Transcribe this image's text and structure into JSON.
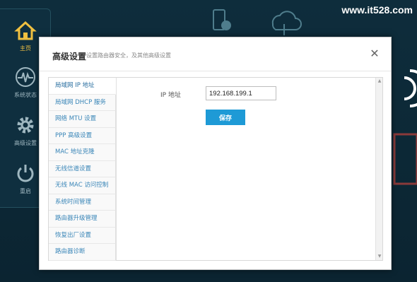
{
  "watermark": "www.it528.com",
  "rail": {
    "items": [
      {
        "label": "主页",
        "icon": "home-icon"
      },
      {
        "label": "系统状态",
        "icon": "pulse-icon"
      },
      {
        "label": "高级设置",
        "icon": "gear-icon"
      },
      {
        "label": "重启",
        "icon": "power-icon"
      }
    ]
  },
  "modal": {
    "title": "高级设置",
    "subtitle": "设置路由器安全，及其他高级设置",
    "close_label": "✕"
  },
  "menu": {
    "items": [
      "局域网 IP 地址",
      "局域网 DHCP 服务",
      "网络 MTU 设置",
      "PPP 高级设置",
      "MAC 地址克隆",
      "无线信道设置",
      "无线 MAC 访问控制",
      "系统时间管理",
      "路由器升级管理",
      "恢复出厂设置",
      "路由器诊断"
    ]
  },
  "form": {
    "ip_label": "IP 地址",
    "ip_value": "192.168.199.1",
    "save_label": "保存"
  },
  "colors": {
    "accent": "#1e9ad6",
    "menu_text": "#3a86b8",
    "background": "#0e2d3c",
    "rail_active": "#f0c040"
  }
}
